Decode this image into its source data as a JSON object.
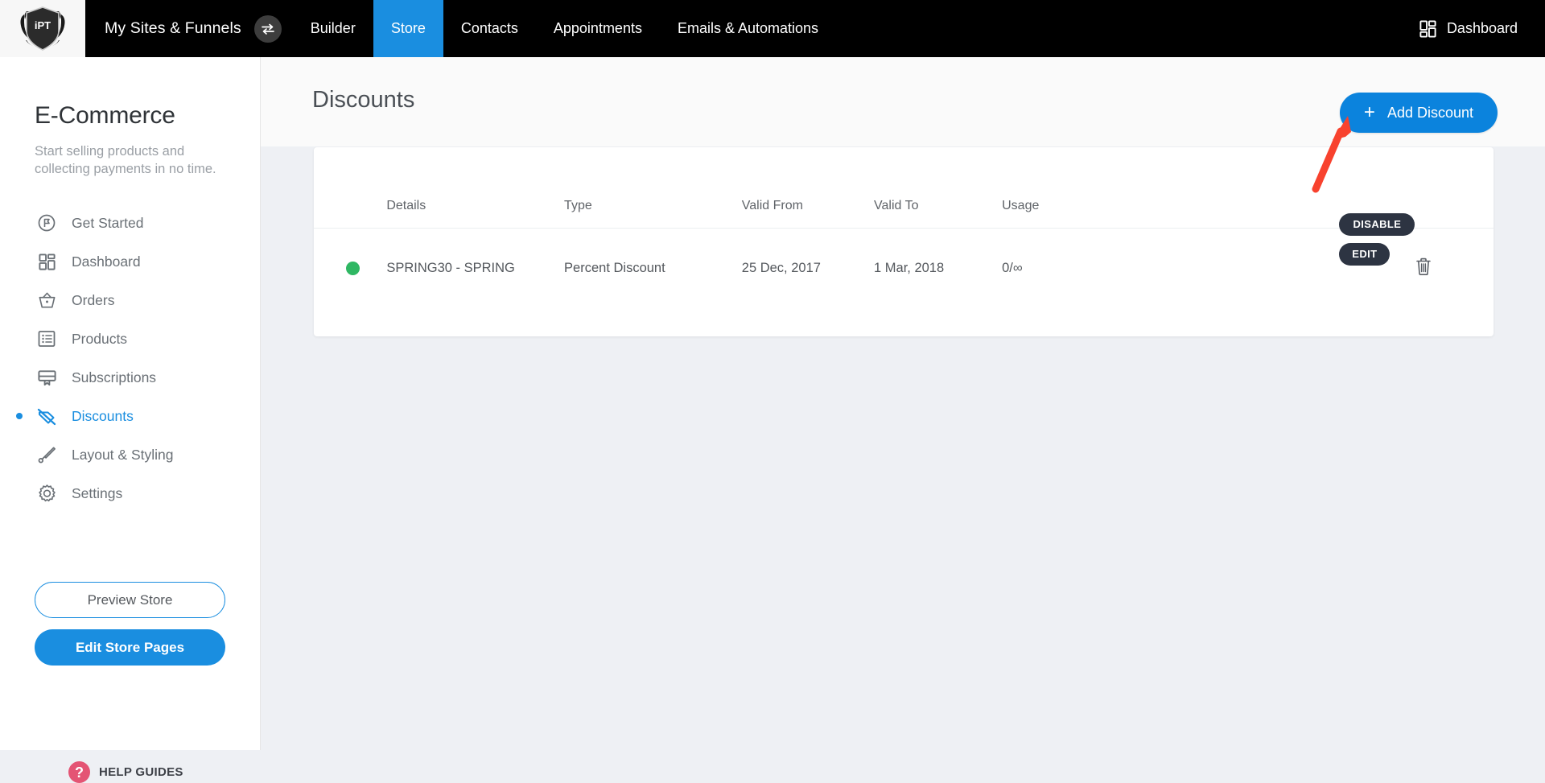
{
  "topnav": {
    "logo_alt": "iPT",
    "brand": "My Sites & Funnels",
    "swap_icon": "swap-arrows-icon",
    "items": [
      {
        "label": "Builder",
        "active": false
      },
      {
        "label": "Store",
        "active": true
      },
      {
        "label": "Contacts",
        "active": false
      },
      {
        "label": "Appointments",
        "active": false
      },
      {
        "label": "Emails & Automations",
        "active": false
      }
    ],
    "right": {
      "icon": "dashboard-grid-icon",
      "label": "Dashboard"
    },
    "colors": {
      "bar_bg": "#000000",
      "active_bg": "#1a8ee0"
    }
  },
  "sidebar": {
    "title": "E-Commerce",
    "subtitle": "Start selling products and collecting payments in no time.",
    "items": [
      {
        "label": "Get Started",
        "icon": "flag-circle-icon",
        "active": false
      },
      {
        "label": "Dashboard",
        "icon": "dashboard-grid-icon",
        "active": false
      },
      {
        "label": "Orders",
        "icon": "basket-icon",
        "active": false
      },
      {
        "label": "Products",
        "icon": "list-box-icon",
        "active": false
      },
      {
        "label": "Subscriptions",
        "icon": "monitor-icon",
        "active": false
      },
      {
        "label": "Discounts",
        "icon": "tag-slash-icon",
        "active": true
      },
      {
        "label": "Layout & Styling",
        "icon": "brush-icon",
        "active": false
      },
      {
        "label": "Settings",
        "icon": "gear-icon",
        "active": false
      }
    ],
    "preview_button": "Preview Store",
    "edit_button": "Edit Store Pages",
    "help": {
      "icon": "question-mark-icon",
      "label": "HELP GUIDES"
    },
    "accent": "#1a8ee0"
  },
  "main": {
    "page_title": "Discounts",
    "add_button": {
      "label": "Add Discount",
      "icon": "plus-icon"
    },
    "table": {
      "columns": [
        "",
        "Details",
        "Type",
        "Valid From",
        "Valid To",
        "Usage",
        "",
        ""
      ],
      "rows": [
        {
          "status": "active",
          "details": "SPRING30 - SPRING",
          "type": "Percent Discount",
          "valid_from": "25 Dec, 2017",
          "valid_to": "1 Mar, 2018",
          "usage": "0/∞",
          "disable_label": "DISABLE",
          "edit_label": "EDIT",
          "delete_icon": "trash-icon"
        }
      ]
    },
    "annotation": {
      "type": "arrow",
      "color": "#f8422e",
      "points_to": "Add Discount"
    }
  }
}
